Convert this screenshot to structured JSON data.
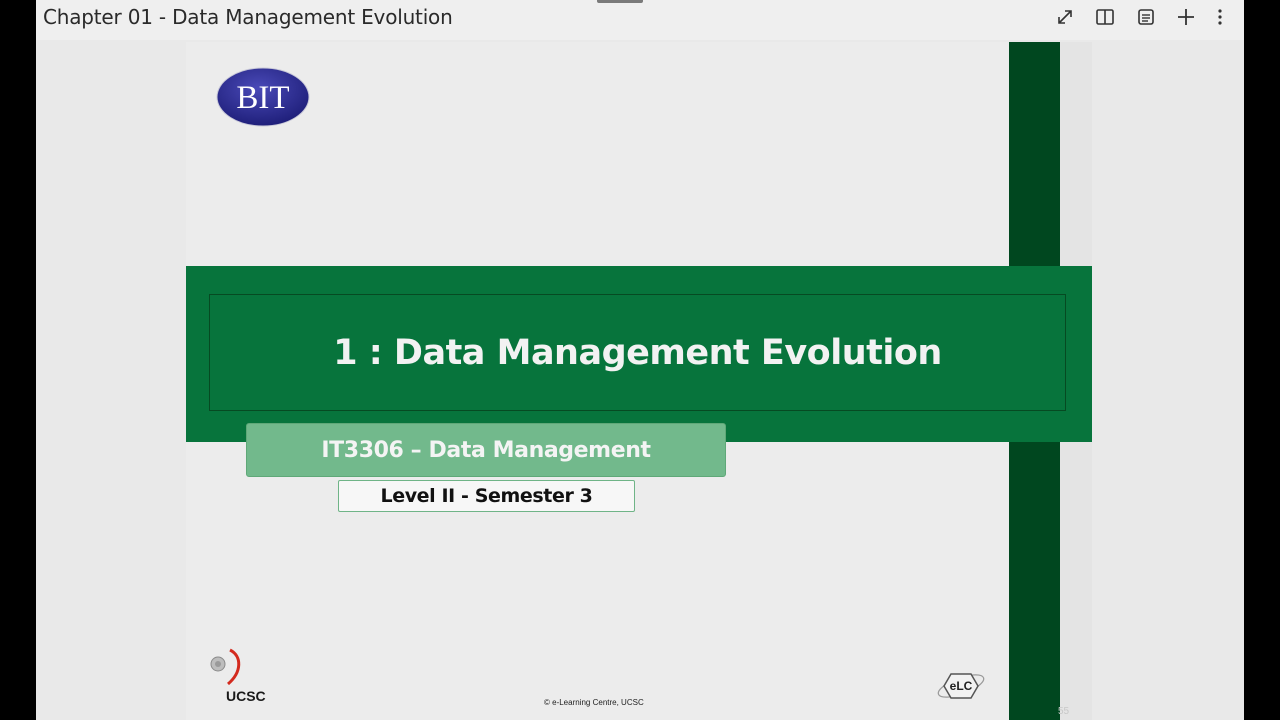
{
  "toolbar": {
    "document_title": "Chapter 01 - Data Management Evolution",
    "icons": [
      "expand-icon",
      "book-view-icon",
      "outline-icon",
      "add-icon",
      "more-options-icon"
    ]
  },
  "slide": {
    "logo_text": "BIT",
    "title": "1 : Data Management Evolution",
    "course": "IT3306 – Data Management",
    "level": "Level II - Semester 3",
    "ucsc_label": "UCSC",
    "elc_label": "eLC",
    "copyright": "© e-Learning Centre, UCSC",
    "page_number": "55"
  },
  "colors": {
    "band_green": "#07743c",
    "dark_green": "#00471f",
    "course_green": "#72b98c",
    "logo_blue": "#2a2a8e"
  }
}
